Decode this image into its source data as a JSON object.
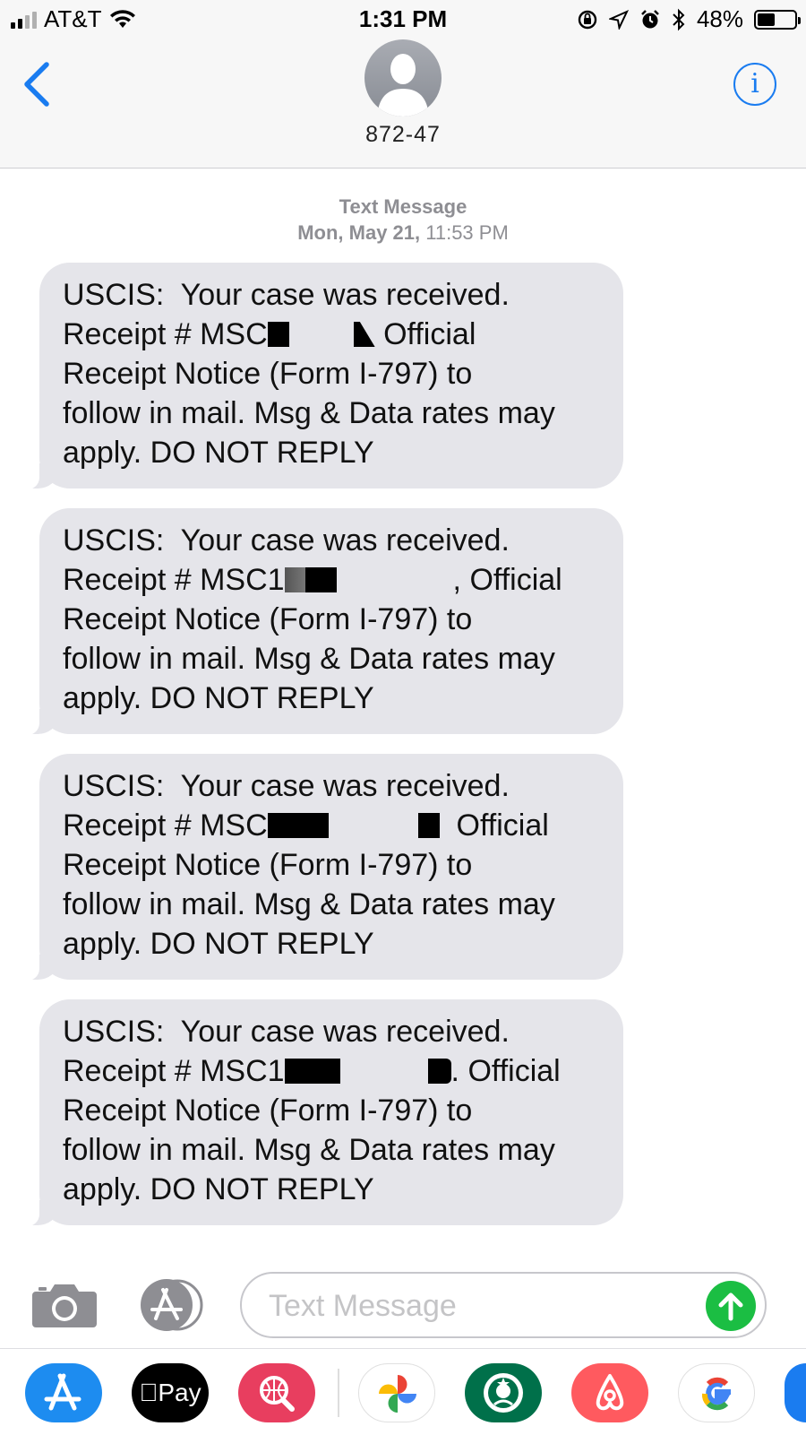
{
  "status_bar": {
    "carrier": "AT&T",
    "time": "1:31 PM",
    "battery": "48%",
    "battery_level": 0.48
  },
  "header": {
    "contact": "872-47"
  },
  "thread": {
    "label": "Text Message",
    "date": "Mon, May 21,",
    "time": "11:53 PM"
  },
  "messages": [
    {
      "line1": "USCIS:  Your case was received.",
      "prefix": "Receipt # MSC",
      "suffix": " Official",
      "line3": "Receipt Notice (Form I-797) to",
      "line4": "follow in mail. Msg & Data rates may",
      "line5": "apply. DO NOT REPLY"
    },
    {
      "line1": "USCIS:  Your case was received.",
      "prefix": "Receipt # MSC1",
      "suffix": ", Official",
      "line3": "Receipt Notice (Form I-797) to",
      "line4": "follow in mail. Msg & Data rates may",
      "line5": "apply. DO NOT REPLY"
    },
    {
      "line1": "USCIS:  Your case was received.",
      "prefix": "Receipt # MSC",
      "suffix": "  Official",
      "line3": "Receipt Notice (Form I-797) to",
      "line4": "follow in mail. Msg & Data rates may",
      "line5": "apply. DO NOT REPLY"
    },
    {
      "line1": "USCIS:  Your case was received.",
      "prefix": "Receipt # MSC1",
      "suffix": ". Official",
      "line3": "Receipt Notice (Form I-797) to",
      "line4": "follow in mail. Msg & Data rates may",
      "line5": "apply. DO NOT REPLY"
    }
  ],
  "composer": {
    "placeholder": "Text Message"
  },
  "drawer": {
    "apps": [
      "app-store-icon",
      "apple-pay-icon",
      "image-search-icon",
      "google-photos-icon",
      "starbucks-icon",
      "airbnb-icon",
      "google-icon"
    ],
    "apple_pay_label": "Pay"
  },
  "colors": {
    "accent": "#1a7cf0",
    "bubble": "#e5e5ea",
    "send": "#1bbe43"
  }
}
